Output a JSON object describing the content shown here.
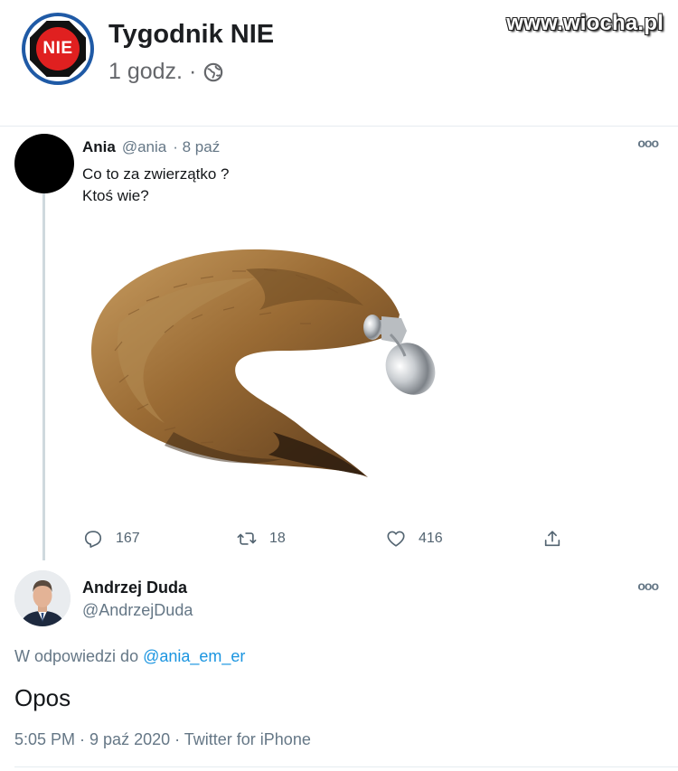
{
  "post": {
    "page_name": "Tygodnik NIE",
    "logo_text": "NIE",
    "time": "1 godz. ·",
    "privacy_icon": "globe-icon"
  },
  "watermark": "www.wiocha.pl",
  "tweet1": {
    "name": "Ania",
    "handle": "@ania",
    "date": "· 8 paź",
    "line1": "Co to za zwierzątko ?",
    "line2": "Ktoś wie?",
    "more": "ooo",
    "actions": {
      "replies": "167",
      "retweets": "18",
      "likes": "416"
    }
  },
  "tweet2": {
    "name": "Andrzej Duda",
    "handle": "@AndrzejDuda",
    "replying_prefix": "W odpowiedzi do",
    "replying_handle": "@ania_em_er",
    "text": "Opos",
    "meta": "5:05 PM · 9 paź 2020 · Twitter for iPhone",
    "more": "ooo"
  },
  "colors": {
    "link": "#1b95e0",
    "secondary_text": "#657786",
    "logo_blue": "#1f5aa6",
    "logo_red": "#e02020"
  }
}
